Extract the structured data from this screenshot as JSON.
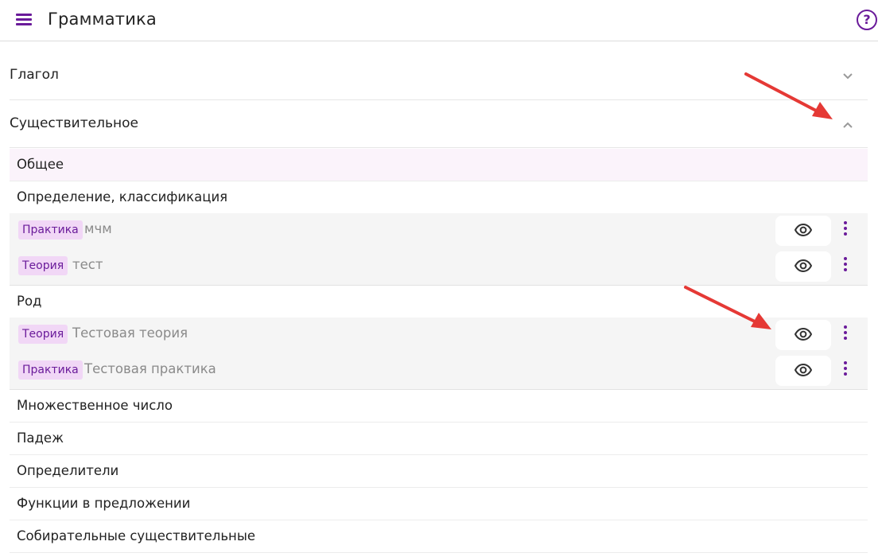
{
  "header": {
    "title": "Грамматика",
    "menu_icon": "hamburger-menu-icon",
    "help_icon": "help-circle-icon",
    "help_glyph": "?",
    "accent_color": "#6a1b9a"
  },
  "sections": [
    {
      "title": "Глагол",
      "expanded": false,
      "chevron": "chevron-down-icon"
    },
    {
      "title": "Существительное",
      "expanded": true,
      "chevron": "chevron-up-icon"
    }
  ],
  "subtopics": [
    {
      "label": "Общее",
      "selected": true
    },
    {
      "label": "Определение, классификация"
    },
    {
      "label": "Род"
    },
    {
      "label": "Множественное число"
    },
    {
      "label": "Падеж"
    },
    {
      "label": "Определители"
    },
    {
      "label": "Функции в предложении"
    },
    {
      "label": "Собирательные существительные"
    }
  ],
  "materials": [
    {
      "type": "Практика",
      "title": "мчм",
      "parent": "Определение, классификация"
    },
    {
      "type": "Теория",
      "title": "тест",
      "parent": "Определение, классификация"
    },
    {
      "type": "Теория",
      "title": "Тестовая теория",
      "parent": "Род"
    },
    {
      "type": "Практика",
      "title": "Тестовая практика",
      "parent": "Род"
    }
  ],
  "icons": {
    "view": "eye-icon",
    "more": "more-vertical-icon"
  },
  "annotation_color": "#e53935"
}
